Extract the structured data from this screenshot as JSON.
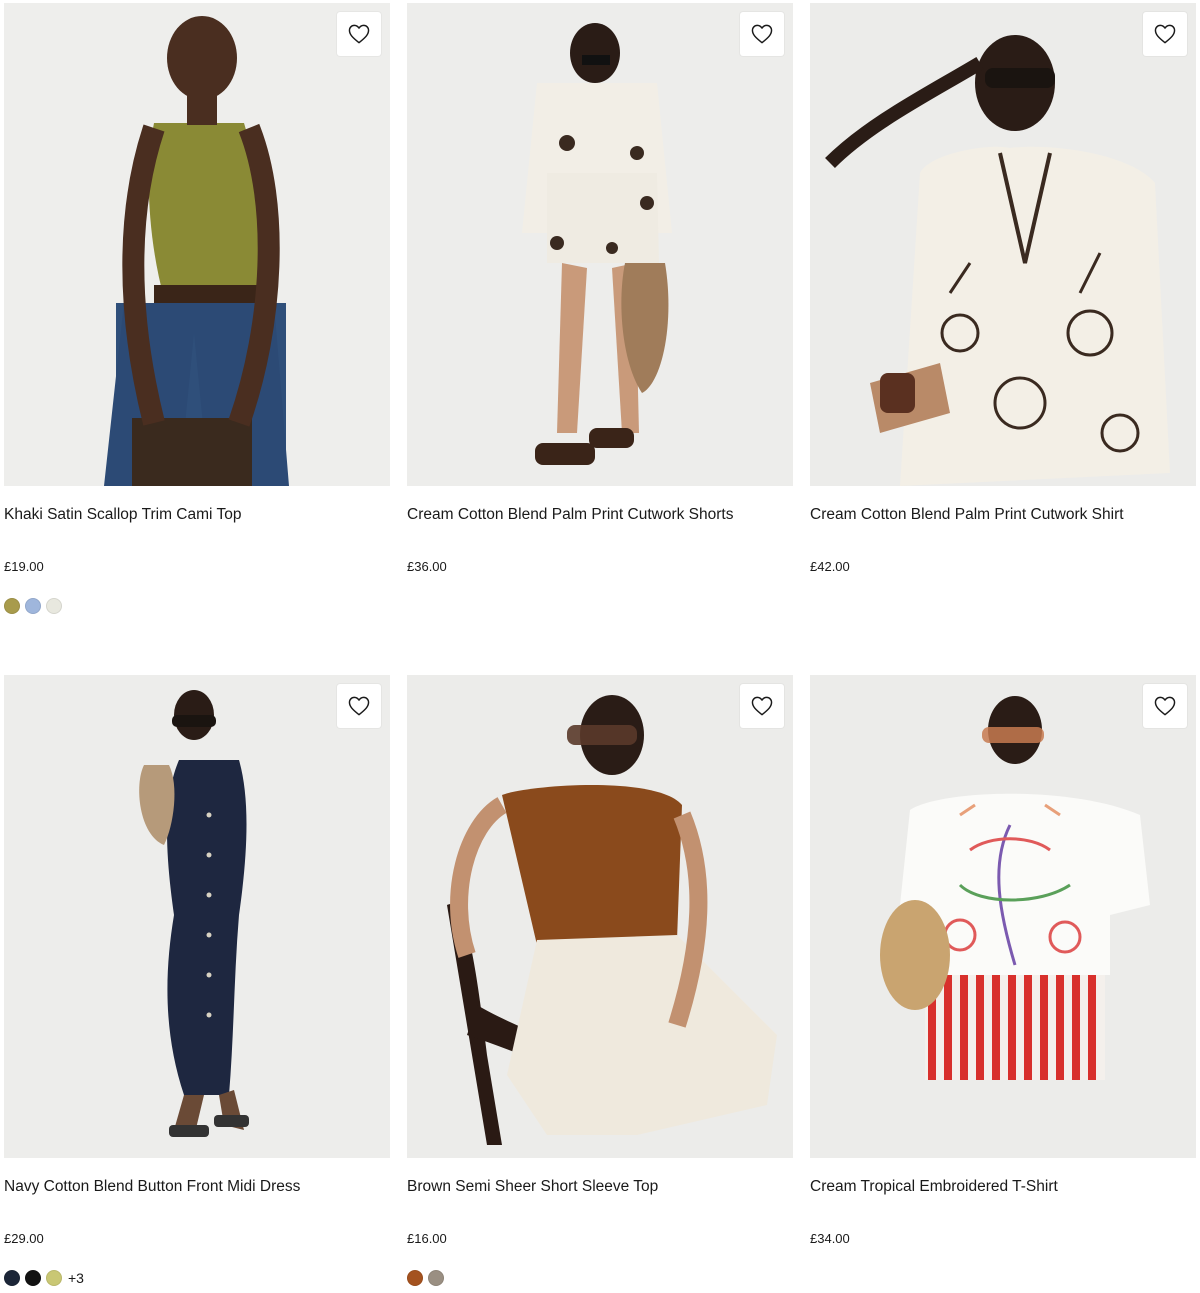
{
  "products": [
    {
      "name": "Khaki Satin Scallop Trim Cami Top",
      "price": "£19.00",
      "swatches": [
        "#a89b4c",
        "#9fb6dc",
        "#e8e8df"
      ],
      "more": ""
    },
    {
      "name": "Cream Cotton Blend Palm Print Cutwork Shorts",
      "price": "£36.00",
      "swatches": [],
      "more": ""
    },
    {
      "name": "Cream Cotton Blend Palm Print Cutwork Shirt",
      "price": "£42.00",
      "swatches": [],
      "more": ""
    },
    {
      "name": "Navy Cotton Blend Button Front Midi Dress",
      "price": "£29.00",
      "swatches": [
        "#1c2638",
        "#121212",
        "#c9c774"
      ],
      "more": "+3"
    },
    {
      "name": "Brown Semi Sheer Short Sleeve Top",
      "price": "£16.00",
      "swatches": [
        "#a4521f",
        "#9a8f82"
      ],
      "more": ""
    },
    {
      "name": "Cream Tropical Embroidered T-Shirt",
      "price": "£34.00",
      "swatches": [],
      "more": ""
    }
  ],
  "icons": {
    "wishlist": "heart-outline-icon"
  }
}
